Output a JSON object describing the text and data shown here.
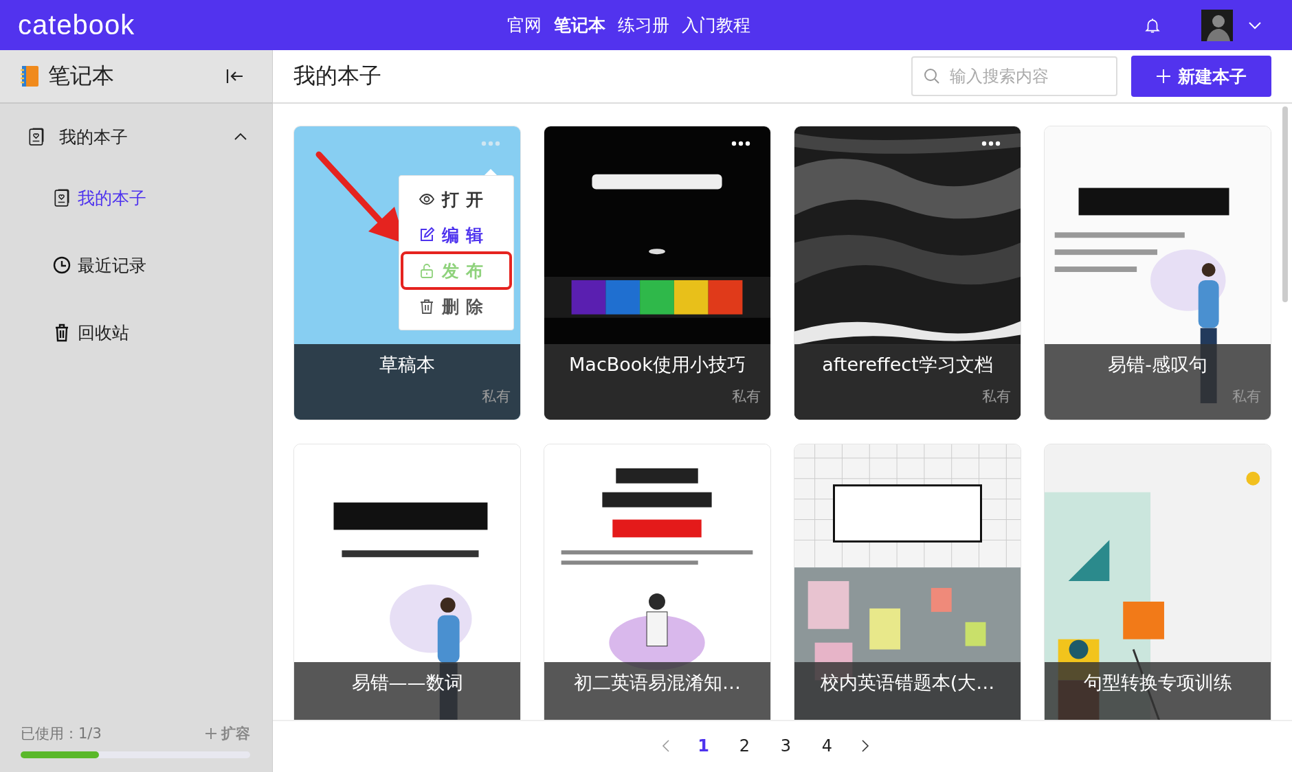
{
  "header": {
    "logo": "catebook",
    "nav": [
      {
        "label": "官网",
        "selected": false
      },
      {
        "label": "笔记本",
        "selected": true
      },
      {
        "label": "练习册",
        "selected": false
      },
      {
        "label": "入门教程",
        "selected": false
      }
    ]
  },
  "sidebar": {
    "title": "笔记本",
    "group": {
      "label": "我的本子",
      "expanded": true,
      "children": [
        {
          "label": "我的本子",
          "kind": "notebook",
          "selected": true
        },
        {
          "label": "最近记录",
          "kind": "clock",
          "selected": false
        },
        {
          "label": "回收站",
          "kind": "trash",
          "selected": false
        }
      ]
    },
    "usage": {
      "label": "已使用：1/3",
      "level": 0.34,
      "expand_button": "扩容"
    }
  },
  "main": {
    "title": "我的本子",
    "search": {
      "placeholder": "输入搜索内容"
    },
    "new_button": "新建本子"
  },
  "cards": [
    {
      "title": "草稿本",
      "visibility": "私有",
      "more_button": true,
      "cover": {
        "kind": "plain"
      },
      "menu": [
        {
          "label": "打开",
          "kind": "eye",
          "color": "#333333",
          "highlighted": false
        },
        {
          "label": "编辑",
          "kind": "edit",
          "color": "#4e33ee",
          "highlighted": false
        },
        {
          "label": "发布",
          "kind": "unlock",
          "color": "#8fd27c",
          "highlighted": true
        },
        {
          "label": "删除",
          "kind": "trash",
          "color": "#555555",
          "highlighted": false
        }
      ]
    },
    {
      "title": "MacBook使用小技巧",
      "visibility": "私有",
      "more_button": true
    },
    {
      "title": "aftereffect学习文档",
      "visibility": "私有",
      "more_button": true
    },
    {
      "title": "易错-感叹句",
      "visibility": "私有",
      "more_button": false
    },
    {
      "title": "易错——数词",
      "more_button": false
    },
    {
      "title": "初二英语易混淆知…",
      "more_button": false
    },
    {
      "title": "校内英语错题本(大…",
      "more_button": false
    },
    {
      "title": "句型转换专项训练",
      "more_button": false
    }
  ],
  "pagination": {
    "pages": [
      {
        "label": "1",
        "selected": true
      },
      {
        "label": "2",
        "selected": false
      },
      {
        "label": "3",
        "selected": false
      },
      {
        "label": "4",
        "selected": false
      }
    ]
  }
}
